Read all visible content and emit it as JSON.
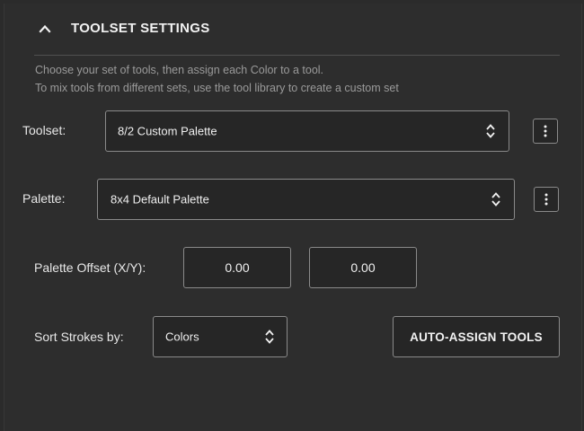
{
  "section": {
    "title": "TOOLSET SETTINGS",
    "description_line1": "Choose your set of tools, then assign each Color to a tool.",
    "description_line2": "To mix tools from different sets, use the tool library to create a custom set"
  },
  "toolset": {
    "label": "Toolset:",
    "selected": "8/2 Custom Palette"
  },
  "palette": {
    "label": "Palette:",
    "selected": "8x4 Default Palette"
  },
  "palette_offset": {
    "label": "Palette Offset (X/Y):",
    "x_value": "0.00",
    "y_value": "0.00"
  },
  "sort_strokes": {
    "label": "Sort Strokes by:",
    "selected": "Colors"
  },
  "auto_assign": {
    "label": "AUTO-ASSIGN TOOLS"
  },
  "icons": {
    "collapse": "chevron-up-icon",
    "more": "more-vertical-icon",
    "select_arrows": "updown-chevron-icon"
  },
  "colors": {
    "panel_bg": "#2d2d2d",
    "field_bg": "#262626",
    "border": "#8a8a8a",
    "text": "#e8e8e8",
    "muted_text": "#9a9a9a"
  }
}
